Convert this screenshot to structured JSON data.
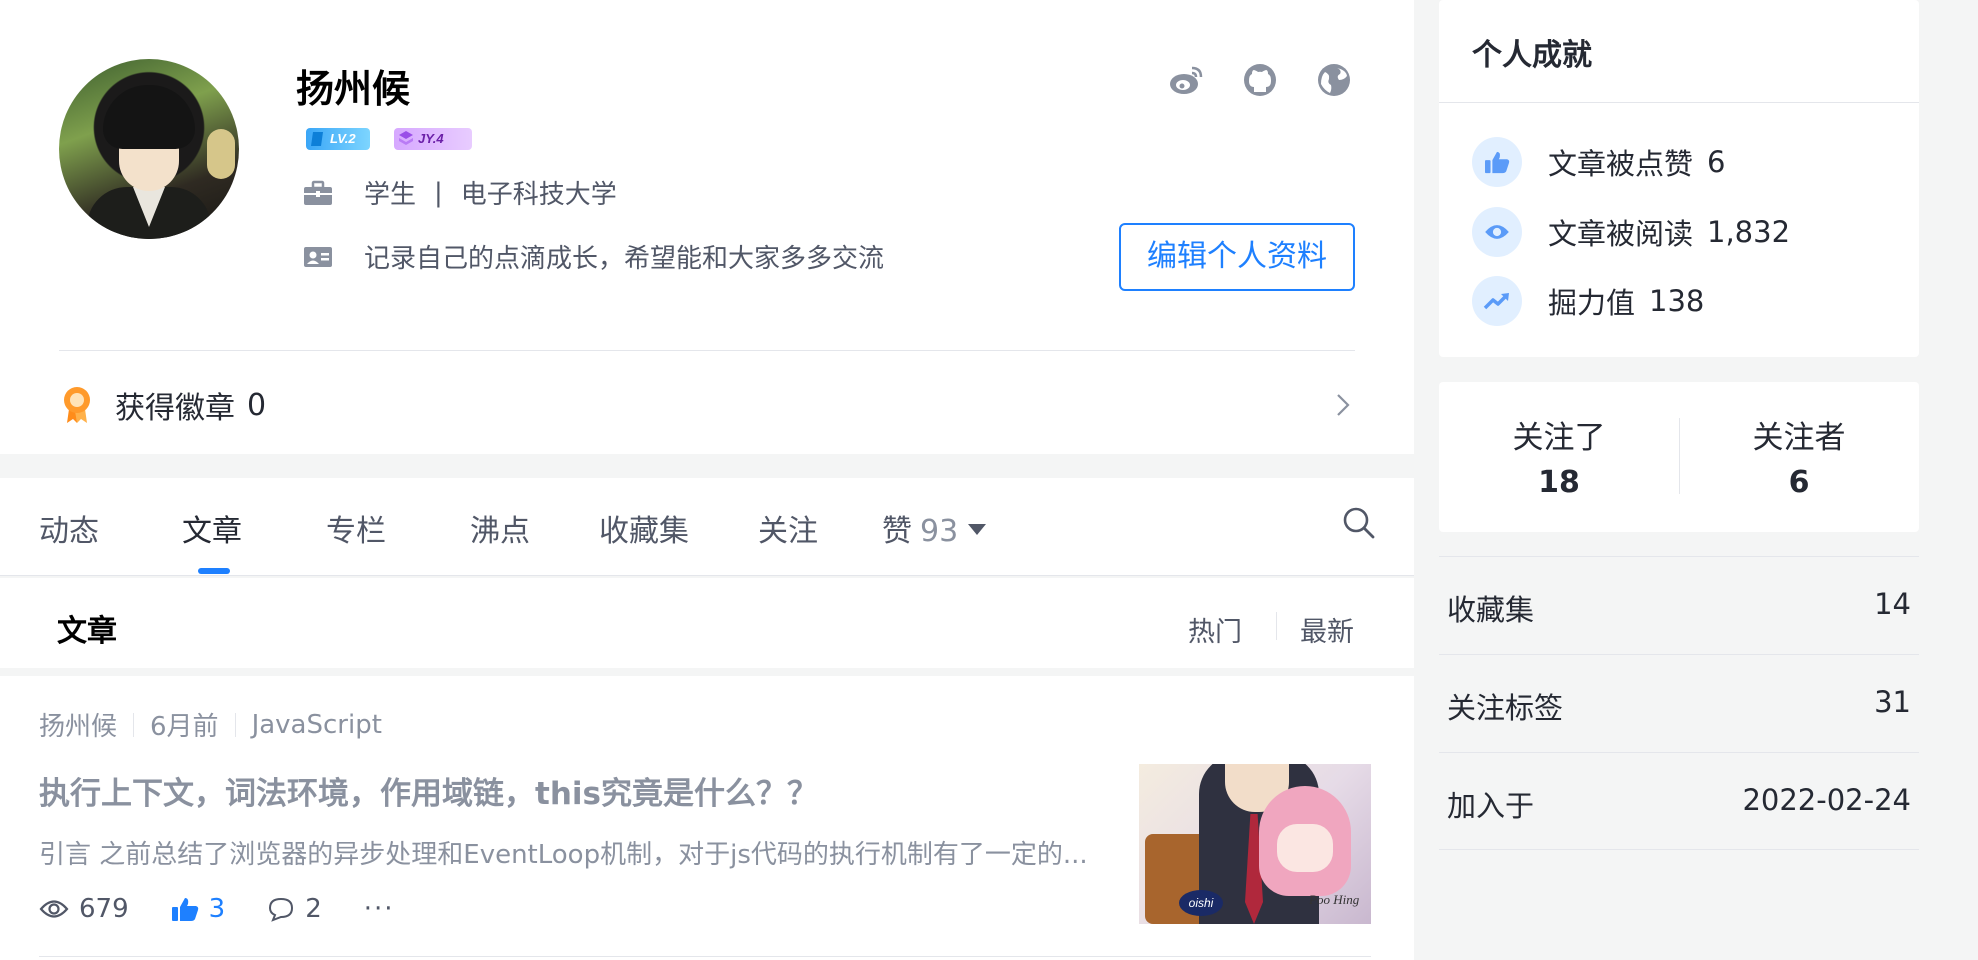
{
  "profile": {
    "name": "扬州候",
    "badges": {
      "level": "LV.2",
      "jy": "JY.4"
    },
    "job_title": "学生",
    "job_separator": "|",
    "company": "电子科技大学",
    "bio": "记录自己的点滴成长，希望能和大家多多交流",
    "edit_button": "编辑个人资料",
    "social_icons": [
      "weibo-icon",
      "github-icon",
      "website-icon"
    ]
  },
  "medals": {
    "label": "获得徽章",
    "count": "0"
  },
  "tabs": {
    "items": [
      "动态",
      "文章",
      "专栏",
      "沸点",
      "收藏集",
      "关注",
      "赞"
    ],
    "active": "文章",
    "likes_count": "93"
  },
  "list": {
    "title": "文章",
    "sort_hot": "热门",
    "sort_new": "最新"
  },
  "article": {
    "author": "扬州候",
    "time": "6月前",
    "tag": "JavaScript",
    "title": "执行上下文，词法环境，作用域链，this究竟是什么？？",
    "summary": "引言 之前总结了浏览器的异步处理和EventLoop机制，对于js代码的执行机制有了一定的...",
    "views": "679",
    "likes": "3",
    "comments": "2",
    "more": "···",
    "thumb_badge": "oishi",
    "thumb_signature": "Poo Hing"
  },
  "achievements": {
    "title": "个人成就",
    "items": [
      {
        "label": "文章被点赞",
        "value": "6",
        "icon": "thumbs-up-icon"
      },
      {
        "label": "文章被阅读",
        "value": "1,832",
        "icon": "eye-icon"
      },
      {
        "label": "掘力值",
        "value": "138",
        "icon": "trend-up-icon"
      }
    ]
  },
  "follow": {
    "following_label": "关注了",
    "following_count": "18",
    "followers_label": "关注者",
    "followers_count": "6"
  },
  "side_list": [
    {
      "label": "收藏集",
      "value": "14"
    },
    {
      "label": "关注标签",
      "value": "31"
    },
    {
      "label": "加入于",
      "value": "2022-02-24"
    }
  ],
  "colors": {
    "accent": "#1e80ff",
    "text_primary": "#252933",
    "text_secondary": "#515767",
    "text_muted": "#8a919f",
    "page_bg": "#f4f5f5"
  }
}
